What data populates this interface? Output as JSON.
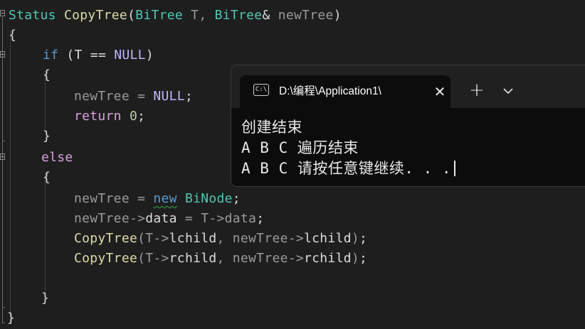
{
  "editor": {
    "lines": {
      "l1": {
        "name": "CopyTree",
        "open": "(",
        "type1": "BiTree",
        "param1": " T, ",
        "type2": "BiTree",
        "amp": "& ",
        "param2": "newTree",
        "close": ")",
        "ret_type": "Status"
      },
      "l2": "{",
      "l3": {
        "kw": "if",
        "rest_a": " (T == ",
        "macro": "NULL",
        "rest_b": ")"
      },
      "l4": "{",
      "l5": {
        "a": "newTree = ",
        "macro": "NULL",
        "b": ";"
      },
      "l6": {
        "kw": "return",
        "sp": " ",
        "num": "0",
        "semi": ";"
      },
      "l7": "}",
      "l8": "else",
      "l9": "{",
      "l10": {
        "a": "newTree = ",
        "kw": "new",
        "sp": " ",
        "type": "BiNode",
        "semi": ";"
      },
      "l11": {
        "a": "newTree->",
        "field": "data",
        "b": " = T->",
        "field2": "data",
        "semi": ";"
      },
      "l12": {
        "fn": "CopyTree",
        "open": "(",
        "a": "T->",
        "f1": "lchild",
        "b": ", newTree->",
        "f2": "lchild",
        "close": ")",
        "semi": ";"
      },
      "l13": {
        "fn": "CopyTree",
        "open": "(",
        "a": "T->",
        "f1": "rchild",
        "b": ", newTree->",
        "f2": "rchild",
        "close": ")",
        "semi": ";"
      },
      "l14": "}",
      "l15": "}"
    }
  },
  "terminal": {
    "tab_icon": "C:\\",
    "tab_title": "D:\\编程\\Application1\\",
    "output": [
      "创建结束",
      "A B C 遍历结束",
      "A B C 请按任意键继续. . ."
    ]
  },
  "colors": {
    "editor_bg": "#1e1e1e",
    "keyword": "#569cd6",
    "type": "#4ec9b0",
    "function": "#dcdcaa",
    "macro": "#beb7ff",
    "terminal_bg": "#0c0c0c"
  },
  "icons": {
    "fold": "collapse-icon",
    "tab": "terminal-icon",
    "close": "close-icon",
    "new_tab": "plus-icon",
    "dropdown": "chevron-down-icon"
  }
}
